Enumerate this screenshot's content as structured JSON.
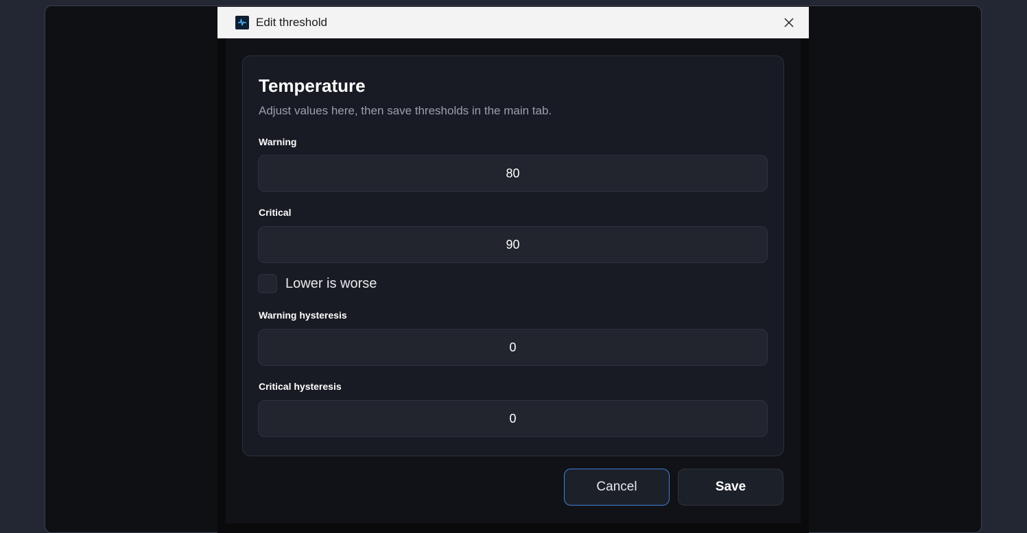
{
  "window": {
    "title": "Edit threshold",
    "close_icon": "close-icon",
    "app_icon": "app-logo-icon"
  },
  "card": {
    "title": "Temperature",
    "subtitle": "Adjust values here, then save thresholds in the main tab."
  },
  "fields": {
    "warning": {
      "label": "Warning",
      "value": "80"
    },
    "critical": {
      "label": "Critical",
      "value": "90"
    },
    "lower_is_worse": {
      "label": "Lower is worse",
      "checked": false
    },
    "warning_hysteresis": {
      "label": "Warning hysteresis",
      "value": "0"
    },
    "critical_hysteresis": {
      "label": "Critical hysteresis",
      "value": "0"
    }
  },
  "buttons": {
    "cancel": "Cancel",
    "save": "Save"
  },
  "colors": {
    "accent": "#3f82d6",
    "background": "#111217",
    "card": "#181b23"
  }
}
